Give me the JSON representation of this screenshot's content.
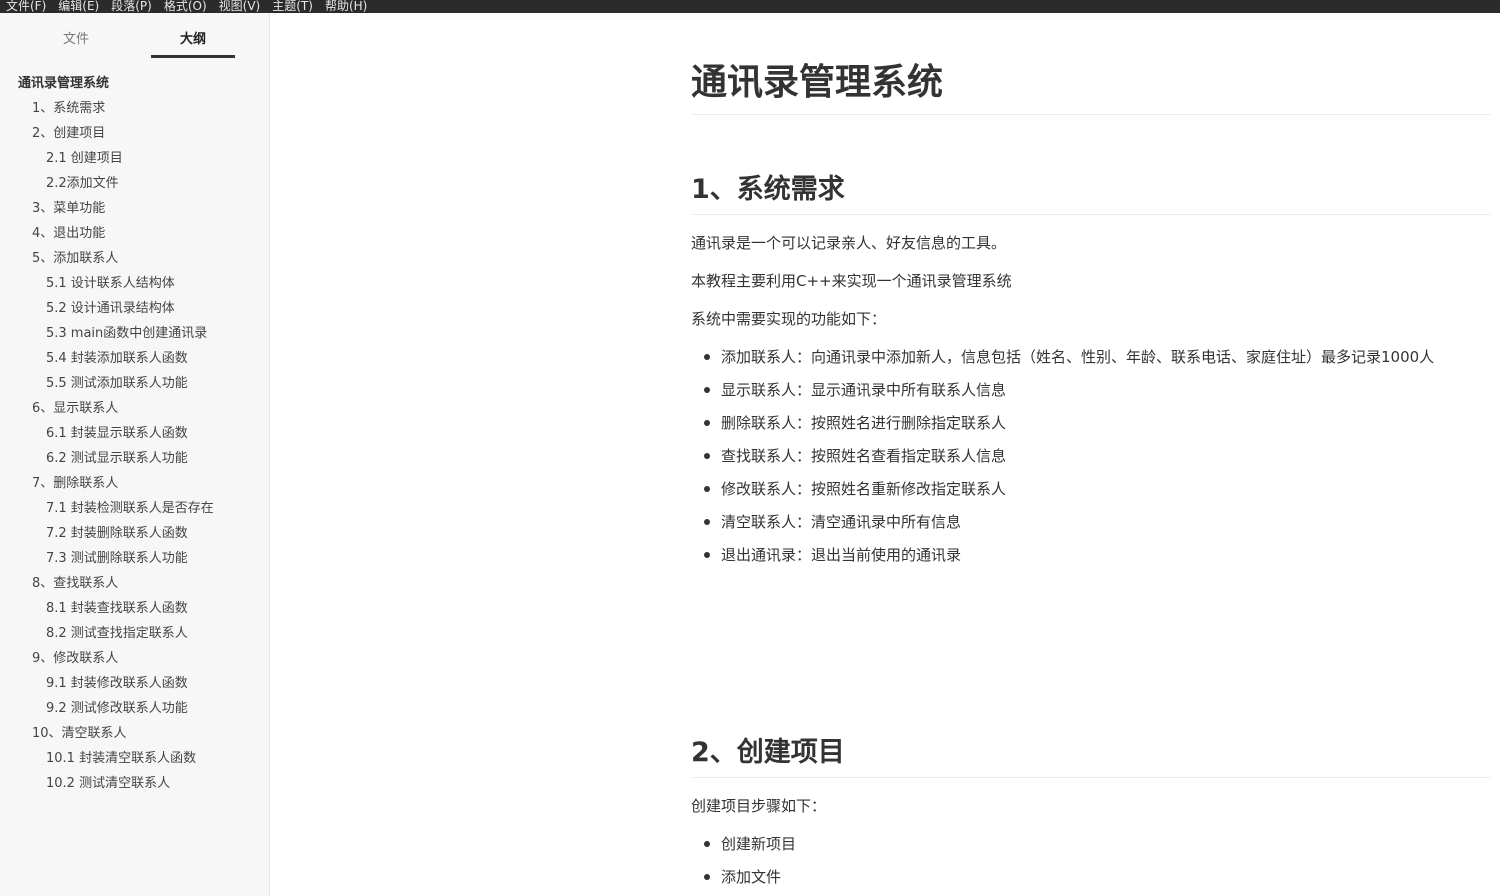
{
  "menu": [
    "文件(F)",
    "编辑(E)",
    "段落(P)",
    "格式(O)",
    "视图(V)",
    "主题(T)",
    "帮助(H)"
  ],
  "sidebar": {
    "tabs": [
      "文件",
      "大纲"
    ],
    "active_tab": "大纲",
    "outline": [
      "通讯录管理系统",
      "1、系统需求",
      "2、创建项目",
      "2.1 创建项目",
      "2.2添加文件",
      "3、菜单功能",
      "4、退出功能",
      "5、添加联系人",
      "5.1 设计联系人结构体",
      "5.2 设计通讯录结构体",
      "5.3 main函数中创建通讯录",
      "5.4 封装添加联系人函数",
      "5.5 测试添加联系人功能",
      "6、显示联系人",
      "6.1 封装显示联系人函数",
      "6.2 测试显示联系人功能",
      "7、删除联系人",
      "7.1 封装检测联系人是否存在",
      "7.2 封装删除联系人函数",
      "7.3 测试删除联系人功能",
      "8、查找联系人",
      "8.1 封装查找联系人函数",
      "8.2 测试查找指定联系人",
      "9、修改联系人",
      "9.1 封装修改联系人函数",
      "9.2 测试修改联系人功能",
      "10、清空联系人",
      "10.1 封装清空联系人函数",
      "10.2 测试清空联系人"
    ]
  },
  "document": {
    "title": "通讯录管理系统",
    "section1": {
      "heading": "1、系统需求",
      "paragraphs": [
        "通讯录是一个可以记录亲人、好友信息的工具。",
        "本教程主要利用C++来实现一个通讯录管理系统",
        "系统中需要实现的功能如下："
      ],
      "list": [
        "添加联系人：向通讯录中添加新人，信息包括（姓名、性别、年龄、联系电话、家庭住址）最多记录1000人",
        "显示联系人：显示通讯录中所有联系人信息",
        "删除联系人：按照姓名进行删除指定联系人",
        "查找联系人：按照姓名查看指定联系人信息",
        "修改联系人：按照姓名重新修改指定联系人",
        "清空联系人：清空通讯录中所有信息",
        "退出通讯录：退出当前使用的通讯录"
      ]
    },
    "section2": {
      "heading": "2、创建项目",
      "paragraphs": [
        "创建项目步骤如下："
      ],
      "list": [
        "创建新项目",
        "添加文件"
      ]
    }
  }
}
